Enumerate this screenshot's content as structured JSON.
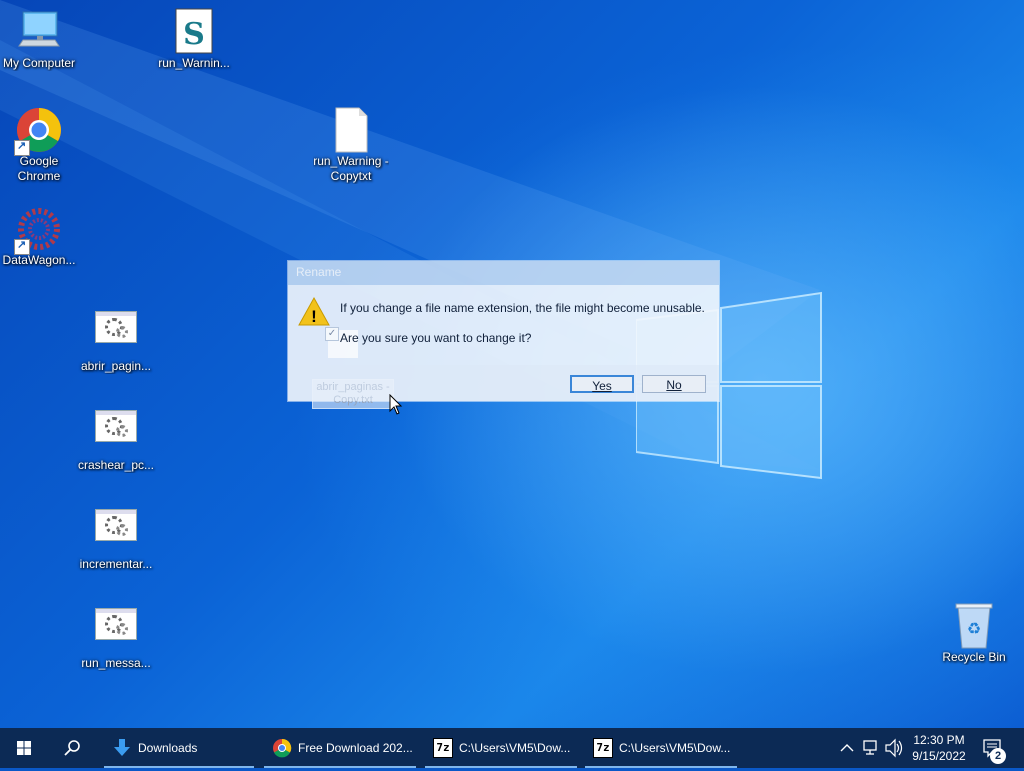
{
  "desktop": {
    "icons": [
      {
        "label": "My Computer"
      },
      {
        "label": "run_Warnin..."
      },
      {
        "label": "Google Chrome"
      },
      {
        "label": "run_Warning - Copytxt"
      },
      {
        "label": "DataWagon..."
      },
      {
        "label": "abrir_pagin..."
      },
      {
        "label": "crashear_pc..."
      },
      {
        "label": "incrementar..."
      },
      {
        "label": "run_messa..."
      },
      {
        "label": "Recycle Bin"
      }
    ]
  },
  "dialog": {
    "title": "Rename",
    "message1": "If you change a file name extension, the file might become unusable.",
    "message2": "Are you sure you want to change it?",
    "yes_label": "Yes",
    "no_label": "No",
    "icon": "warning-icon",
    "dragged_file_label": "abrir_paginas - Copy.txt"
  },
  "taskbar": {
    "items": [
      {
        "label": "Downloads",
        "icon": "download-arrow-icon"
      },
      {
        "label": "Free Download 202...",
        "icon": "chrome-icon"
      },
      {
        "label": "C:\\Users\\VM5\\Dow...",
        "icon": "7zip-icon"
      },
      {
        "label": "C:\\Users\\VM5\\Dow...",
        "icon": "7zip-icon"
      }
    ],
    "time": "12:30 PM",
    "date": "9/15/2022",
    "notification_count": "2",
    "sevenzip_glyph": "7z"
  }
}
